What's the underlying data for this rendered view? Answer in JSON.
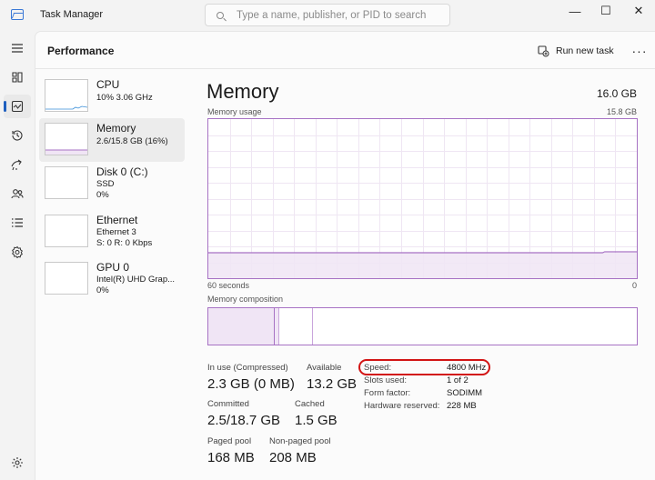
{
  "window": {
    "title": "Task Manager",
    "search_placeholder": "Type a name, publisher, or PID to search",
    "minimize": "—",
    "maximize": "☐",
    "close": "✕"
  },
  "header": {
    "title": "Performance",
    "run_new_task": "Run new task",
    "more": "···"
  },
  "devices": [
    {
      "name": "CPU",
      "lines": [
        "10%  3.06 GHz"
      ]
    },
    {
      "name": "Memory",
      "lines": [
        "2.6/15.8 GB (16%)"
      ]
    },
    {
      "name": "Disk 0 (C:)",
      "lines": [
        "SSD",
        "0%"
      ]
    },
    {
      "name": "Ethernet",
      "lines": [
        "Ethernet 3",
        "S: 0 R: 0 Kbps"
      ]
    },
    {
      "name": "GPU 0",
      "lines": [
        "Intel(R) UHD Grap...",
        "0%"
      ]
    }
  ],
  "detail": {
    "title": "Memory",
    "total": "16.0 GB",
    "usage_label": "Memory usage",
    "usage_max": "15.8 GB",
    "time_left": "60 seconds",
    "time_right": "0",
    "composition_label": "Memory composition",
    "usage_level_fraction": 0.16,
    "stats": {
      "in_use_label": "In use (Compressed)",
      "in_use_value": "2.3 GB (0 MB)",
      "available_label": "Available",
      "available_value": "13.2 GB",
      "committed_label": "Committed",
      "committed_value": "2.5/18.7 GB",
      "cached_label": "Cached",
      "cached_value": "1.5 GB",
      "paged_label": "Paged pool",
      "paged_value": "168 MB",
      "nonpaged_label": "Non-paged pool",
      "nonpaged_value": "208 MB"
    },
    "properties": [
      {
        "key": "Speed:",
        "value": "4800 MHz"
      },
      {
        "key": "Slots used:",
        "value": "1 of 2"
      },
      {
        "key": "Form factor:",
        "value": "SODIMM"
      },
      {
        "key": "Hardware reserved:",
        "value": "228 MB"
      }
    ]
  },
  "colors": {
    "accent": "#1f5fbf",
    "memory_purple": "#a772c4",
    "memory_fill": "#f0e5f5",
    "highlight_red": "#d21414"
  }
}
